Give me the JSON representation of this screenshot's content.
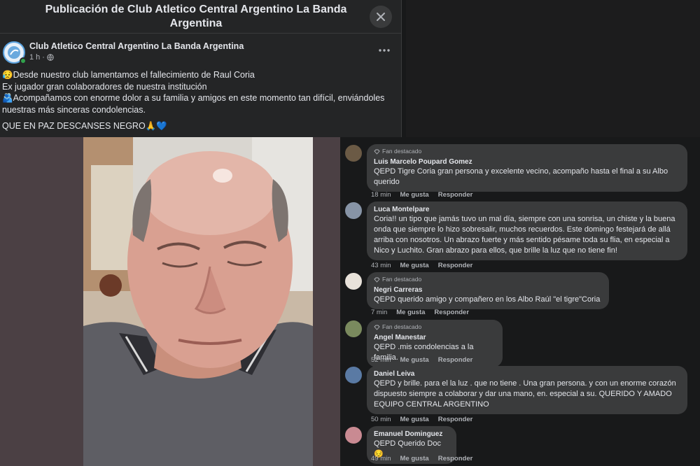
{
  "dialog": {
    "title": "Publicación de Club Atletico Central Argentino La Banda Argentina"
  },
  "post": {
    "author": "Club Atletico Central Argentino La Banda Argentina",
    "time": "1 h",
    "privacy_icon": "globe-icon",
    "lines": [
      "😥Desde nuestro club lamentamos  el fallecimiento de Raul Coria",
      "Ex jugador gran colaboradores de nuestra institución",
      "🫂Acompañamos con enorme dolor a su familia y amigos en este momento tan difícil, enviándoles",
      "nuestras más sinceras condolencias."
    ],
    "closing": "QUE EN PAZ DESCANSES NEGRO🙏💙"
  },
  "actions_labels": {
    "like": "Me gusta",
    "reply": "Responder"
  },
  "comments": [
    {
      "badge": "Fan destacado",
      "author": "Luis Marcelo Poupard Gomez",
      "lines": [
        "QEPD Tigre Coria gran persona y excelente vecino, acompaño hasta el final a su Albo",
        "querido"
      ],
      "time": "18 min"
    },
    {
      "badge": "",
      "author": "Luca Montelpare",
      "lines": [
        "Coria!! un tipo que jamás tuvo un mal día, siempre con una sonrisa, un chiste y la buena",
        "onda que siempre lo hizo sobresalir, muchos recuerdos. Este domingo festejará de allá",
        "arriba con nosotros. Un abrazo fuerte y más sentido pésame toda su flia, en especial a",
        "Nico y Luchito. Gran abrazo para ellos, que brille la luz que no tiene fin!"
      ],
      "time": "43 min"
    },
    {
      "badge": "Fan destacado",
      "author": "Negri Carreras",
      "lines": [
        "QEPD querido amigo y compañero en los Albo Raúl \"el tigre\"Coria"
      ],
      "time": "7 min"
    },
    {
      "badge": "Fan destacado",
      "author": "Angel Manestar",
      "lines": [
        "QEPD .mis condolencias a la familia."
      ],
      "time": "52 min"
    },
    {
      "badge": "",
      "author": "Daniel Leiva",
      "lines": [
        "QEPD y brille. para el la luz . que no tiene . Una gran persona. y con un enorme corazón",
        "dispuesto siempre a colaborar y dar una mano, en. especial a su. QUERIDO Y AMADO",
        "EQUIPO CENTRAL ARGENTINO"
      ],
      "time": "50 min"
    },
    {
      "badge": "",
      "author": "Emanuel Dominguez",
      "lines": [
        "QEPD Querido Doc 😔"
      ],
      "time": "49 min"
    }
  ],
  "colors": {
    "panel_bg": "#242526",
    "bubble_bg": "#3a3b3c",
    "text_primary": "#e4e6eb",
    "text_secondary": "#b0b3b8",
    "online": "#31a24c"
  }
}
